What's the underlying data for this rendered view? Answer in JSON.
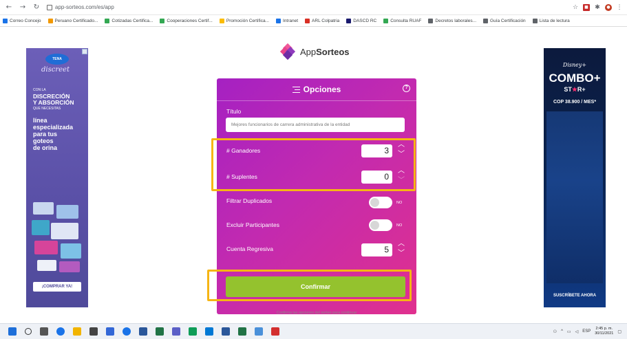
{
  "browser": {
    "url": "app-sorteos.com/es/app",
    "bookmarks": [
      {
        "label": "Correo Concejo",
        "color": "#1a73e8"
      },
      {
        "label": "Peruano Certificado...",
        "color": "#f29900"
      },
      {
        "label": "Cotizadas Certifica...",
        "color": "#34a853"
      },
      {
        "label": "Cooperaciones Certif...",
        "color": "#34a853"
      },
      {
        "label": "Promoción Certifica...",
        "color": "#fbbc04"
      },
      {
        "label": "Intranet",
        "color": "#1a73e8"
      },
      {
        "label": "ARL Colpatria",
        "color": "#d93025"
      },
      {
        "label": "DASCD RC",
        "color": "#1a1a6e"
      },
      {
        "label": "Consulta RUAF",
        "color": "#34a853"
      },
      {
        "label": "Decretos laborales...",
        "color": "#5f6368"
      },
      {
        "label": "Guía Certificación",
        "color": "#5f6368"
      },
      {
        "label": "Lista de lectura",
        "color": "#5f6368"
      }
    ]
  },
  "ads": {
    "left": {
      "brand": "TENA",
      "script": "discreet",
      "line1": "CON LA",
      "line2": "DISCRECIÓN",
      "line3": "Y ABSORCIÓN",
      "line4": "QUE NECESITAS",
      "line5": "línea",
      "line6": "especializada",
      "line7": "para tus",
      "line8": "goteos",
      "line9": "de orina",
      "cta": "¡COMPRAR YA!"
    },
    "right": {
      "brand": "Disney+",
      "combo": "COMBO+",
      "star_prefix": "ST",
      "star_glyph": "★",
      "star_suffix": "R+",
      "price": "COP 38.900 / MES*",
      "cta": "SUSCRÍBETE AHORA"
    }
  },
  "app": {
    "logo_prefix": "App",
    "logo_suffix": "Sorteos",
    "header": "Opciones",
    "title_label": "Título",
    "title_value": "Mejores funcionarios de carrera administrativa de la entidad",
    "winners_label": "# Ganadores",
    "winners_value": "3",
    "substitutes_label": "# Suplentes",
    "substitutes_value": "0",
    "filter_duplicates_label": "Filtrar Duplicados",
    "filter_duplicates_state": "NO",
    "exclude_participants_label": "Excluir Participantes",
    "exclude_participants_state": "NO",
    "countdown_label": "Cuenta Regresiva",
    "countdown_value": "5",
    "confirm_label": "Confirmar",
    "footer_note": "Confirma las opciones del sorteo para continuar"
  },
  "taskbar": {
    "clock_time": "2:45 p. m.",
    "clock_date": "30/11/2021",
    "lang": "ESP"
  },
  "colors": {
    "card_start": "#a521c2",
    "card_end": "#e0308e",
    "confirm": "#94c22e",
    "highlight": "#f6b514"
  }
}
